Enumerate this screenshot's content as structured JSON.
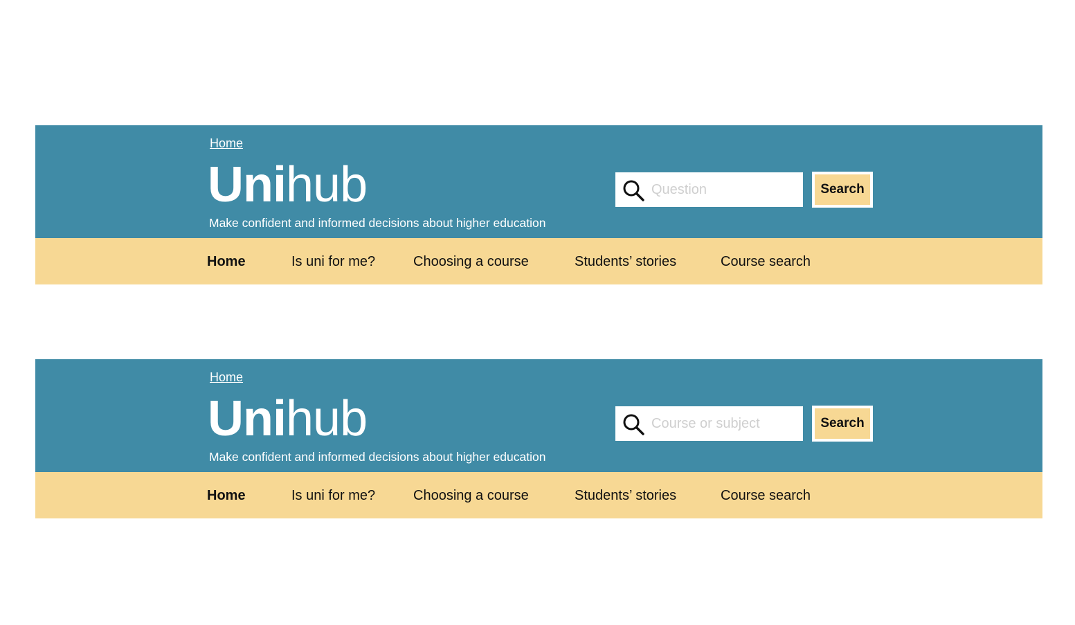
{
  "headers": [
    {
      "breadcrumb": "Home",
      "title_bold": "Uni",
      "title_light": "hub",
      "tagline": "Make confident and informed decisions about higher education",
      "search_placeholder": "Question",
      "search_button": "Search",
      "nav": [
        "Home",
        "Is uni for me?",
        "Choosing a course",
        "Students’ stories",
        "Course search"
      ],
      "nav_active": "Home"
    },
    {
      "breadcrumb": "Home",
      "title_bold": "Uni",
      "title_light": "hub",
      "tagline": "Make confident and informed decisions about higher education",
      "search_placeholder": "Course or subject",
      "search_button": "Search",
      "nav": [
        "Home",
        "Is uni for me?",
        "Choosing a course",
        "Students’ stories",
        "Course search"
      ],
      "nav_active": "Home"
    }
  ],
  "colors": {
    "banner": "#408ba6",
    "nav_bar": "#f7d894",
    "button": "#f7d894",
    "text_light": "#ffffff",
    "text_dark": "#111111",
    "placeholder": "#cfcfcf"
  },
  "icons": {
    "search": "magnifier-icon"
  }
}
